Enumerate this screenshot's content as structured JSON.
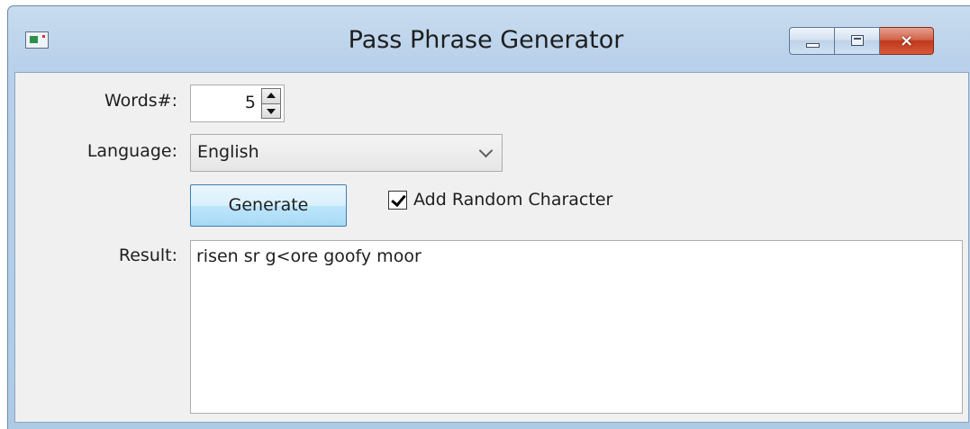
{
  "window": {
    "title": "Pass Phrase Generator",
    "icon": "app-window-icon",
    "controls": {
      "minimize": "minimize-icon",
      "maximize": "maximize-icon",
      "close": "×"
    }
  },
  "form": {
    "words_label": "Words#:",
    "words_value": "5",
    "language_label": "Language:",
    "language_value": "English",
    "generate_label": "Generate",
    "random_char_label": "Add Random Character",
    "random_char_checked": true,
    "result_label": "Result:",
    "result_value": "risen sr g<ore goofy moor"
  }
}
